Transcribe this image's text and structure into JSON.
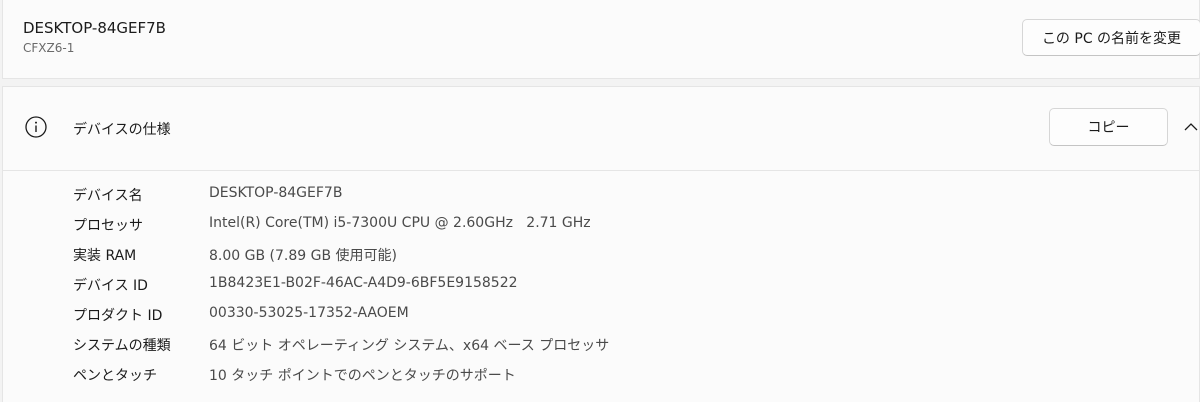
{
  "device": {
    "name": "DESKTOP-84GEF7B",
    "model": "CFXZ6-1",
    "rename_label": "この PC の名前を変更"
  },
  "specs": {
    "title": "デバイスの仕様",
    "copy_label": "コピー",
    "rows": [
      {
        "label": "デバイス名",
        "value": "DESKTOP-84GEF7B"
      },
      {
        "label": "プロセッサ",
        "value": "Intel(R) Core(TM) i5-7300U CPU @ 2.60GHz   2.71 GHz"
      },
      {
        "label": "実装 RAM",
        "value": "8.00 GB (7.89 GB 使用可能)"
      },
      {
        "label": "デバイス ID",
        "value": "1B8423E1-B02F-46AC-A4D9-6BF5E9158522"
      },
      {
        "label": "プロダクト ID",
        "value": "00330-53025-17352-AAOEM"
      },
      {
        "label": "システムの種類",
        "value": "64 ビット オペレーティング システム、x64 ベース プロセッサ"
      },
      {
        "label": "ペンとタッチ",
        "value": "10 タッチ ポイントでのペンとタッチのサポート"
      }
    ]
  },
  "icons": {
    "info": "info-icon",
    "chevron": "chevron-up-icon"
  }
}
